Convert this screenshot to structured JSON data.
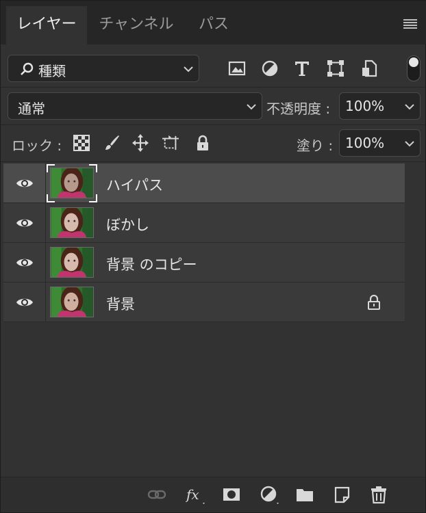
{
  "tabs": [
    {
      "label": "レイヤー",
      "active": true
    },
    {
      "label": "チャンネル",
      "active": false
    },
    {
      "label": "パス",
      "active": false
    }
  ],
  "panel_menu_icon": "hamburger-menu-icon",
  "filter": {
    "kind_label": "種類",
    "icons": [
      "image-filter-icon",
      "adjustment-filter-icon",
      "type-filter-icon",
      "shape-filter-icon",
      "smart-object-filter-icon"
    ],
    "toggle_on": true
  },
  "blend": {
    "mode": "通常",
    "opacity_label": "不透明度 :",
    "opacity": "100%"
  },
  "lock": {
    "label": "ロック :",
    "icons": [
      "lock-transparent-pixels-icon",
      "lock-image-pixels-icon",
      "lock-position-icon",
      "lock-artboard-icon",
      "lock-all-icon"
    ],
    "fill_label": "塗り :",
    "fill": "100%"
  },
  "layers": [
    {
      "name": "ハイパス",
      "visible": true,
      "selected": true,
      "locked": false
    },
    {
      "name": "ぼかし",
      "visible": true,
      "selected": false,
      "locked": false
    },
    {
      "name": "背景 のコピー",
      "visible": true,
      "selected": false,
      "locked": false
    },
    {
      "name": "背景",
      "visible": true,
      "selected": false,
      "locked": true
    }
  ],
  "footer_icons": [
    "link-layers-icon",
    "fx-icon",
    "add-mask-icon",
    "new-adjustment-icon",
    "new-group-icon",
    "new-layer-icon",
    "delete-layer-icon"
  ],
  "colors": {
    "panel_bg": "#323232",
    "tabbar_bg": "#262626",
    "layer_bg": "#3a3a3a",
    "layer_selected_bg": "#4c4c4c",
    "text": "#e6e6e6",
    "icon": "#d8d8d8"
  }
}
